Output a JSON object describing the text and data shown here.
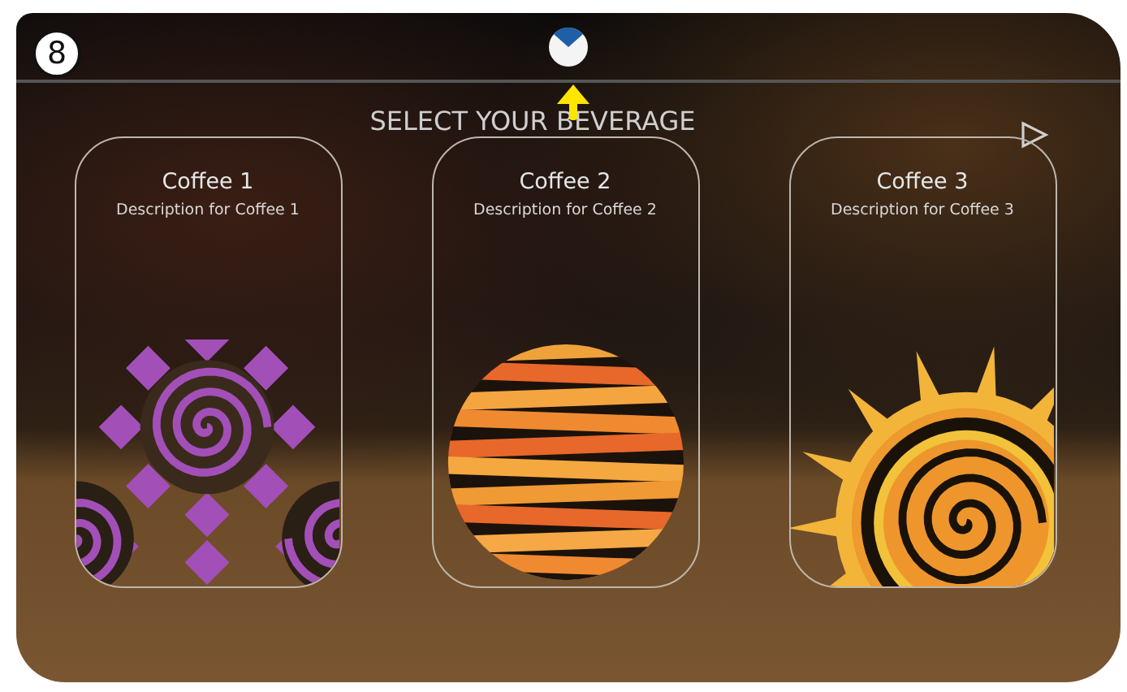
{
  "callout": {
    "number": "8"
  },
  "heading": "SELECT YOUR BEVERAGE",
  "cards": [
    {
      "title": "Coffee 1",
      "description": "Description for Coffee 1",
      "kind": "spiral-pattern"
    },
    {
      "title": "Coffee 2",
      "description": "Description for Coffee 2",
      "kind": "striped-sphere"
    },
    {
      "title": "Coffee 3",
      "description": "Description for Coffee 3",
      "kind": "sun-spiral"
    }
  ]
}
